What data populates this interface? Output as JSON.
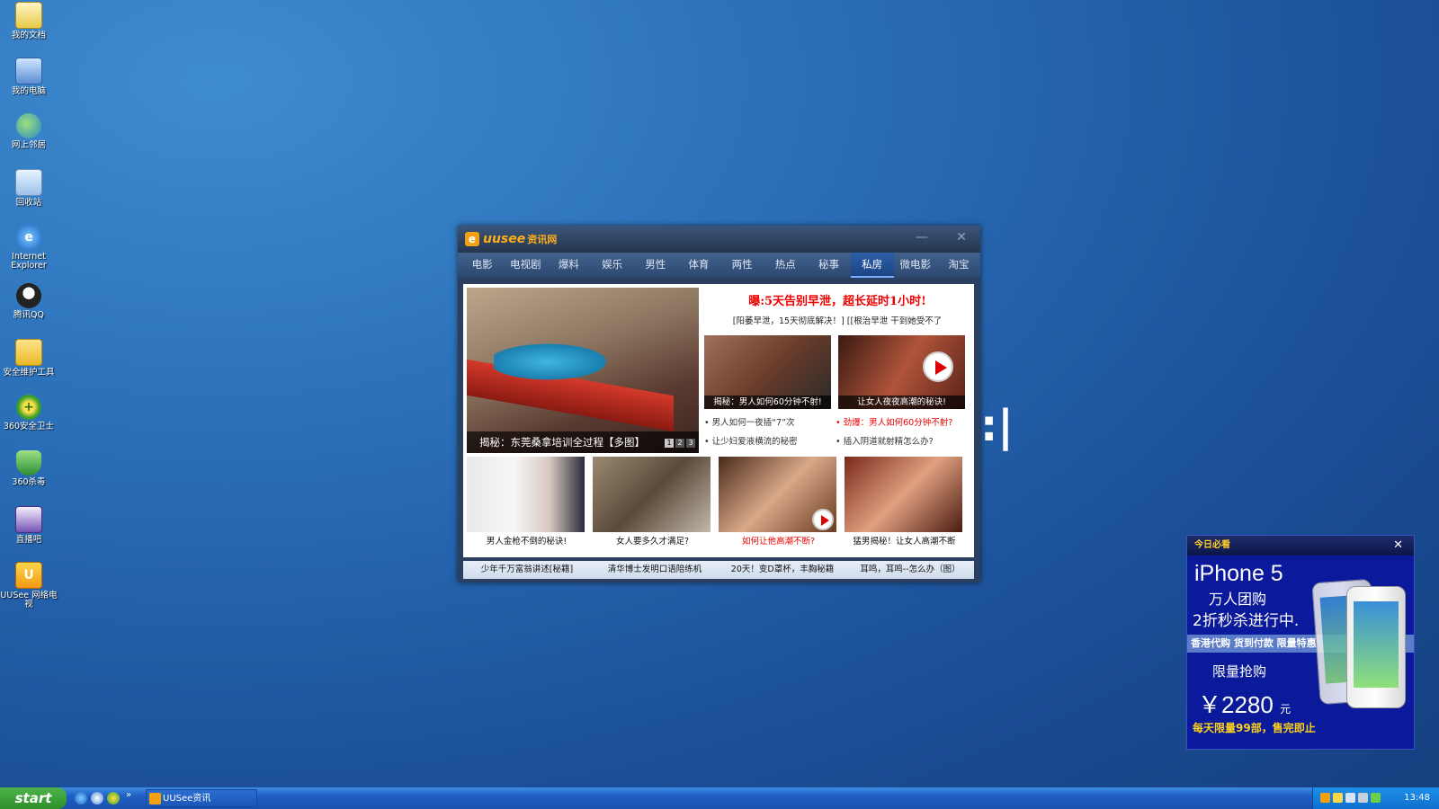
{
  "desktop": {
    "icons": [
      {
        "label": "我的文档",
        "icon": "documents-icon"
      },
      {
        "label": "我的电脑",
        "icon": "computer-icon"
      },
      {
        "label": "网上邻居",
        "icon": "network-icon"
      },
      {
        "label": "回收站",
        "icon": "recycle-bin-icon"
      },
      {
        "label": "Internet Explorer",
        "icon": "ie-icon"
      },
      {
        "label": "腾讯QQ",
        "icon": "qq-icon"
      },
      {
        "label": "安全维护工具",
        "icon": "folder-icon"
      },
      {
        "label": "360安全卫士",
        "icon": "360-safe-icon"
      },
      {
        "label": "360杀毒",
        "icon": "360-antivirus-icon"
      },
      {
        "label": "直播吧",
        "icon": "zhiboba-icon"
      },
      {
        "label": "UUSee 网络电视",
        "icon": "uusee-icon"
      }
    ],
    "stray_text": ":|"
  },
  "popup": {
    "brand": "uusee",
    "brand_sub": "资讯网",
    "nav": [
      "电影",
      "电视剧",
      "爆料",
      "娱乐",
      "男性",
      "体育",
      "两性",
      "热点",
      "秘事",
      "私房",
      "微电影",
      "淘宝"
    ],
    "active_tab": "私房",
    "hero": {
      "caption": "揭秘：东莞桑拿培训全过程【多图】",
      "pager": [
        "1",
        "2",
        "3"
      ]
    },
    "headline": "曝:5天告别早泄，超长延时1小时!",
    "subline": "[阳萎早泄，15天彻底解决！]  [[根治早泄  干到她受不了",
    "thumbs": [
      {
        "caption": "揭秘：男人如何60分钟不射!"
      },
      {
        "caption": "让女人夜夜高潮的秘诀!"
      }
    ],
    "links_left": [
      "• 男人如何一夜插“7”次",
      "• 让少妇爱液横流的秘密"
    ],
    "links_right": [
      {
        "text": "• 劲爆：男人如何60分钟不射?",
        "red": true
      },
      {
        "text": "• 插入阴道就射精怎么办?",
        "red": false
      }
    ],
    "gallery": [
      {
        "caption": "男人金枪不倒的秘诀!",
        "red": false
      },
      {
        "caption": "女人要多久才满足?",
        "red": false
      },
      {
        "caption": "如何让他高潮不断?",
        "red": true
      },
      {
        "caption": "猛男揭秘！让女人高潮不断",
        "red": false
      }
    ],
    "footer": [
      "少年千万富翁讲述[秘籍]",
      "清华博士发明口语陪练机",
      "20天！变D罩杯，丰胸秘籍",
      "耳鸣，耳鸣--怎么办（图）"
    ]
  },
  "ad": {
    "header": "今日必看",
    "line1": "iPhone 5",
    "line2": "万人团购",
    "line3": "2折秒杀进行中.",
    "band": "香港代购 货到付款 限量特惠",
    "line4": "限量抢购",
    "price": "￥2280",
    "price_unit": "元",
    "line5": "每天限量99部，售完即止"
  },
  "taskbar": {
    "start": "start",
    "window_button": "UUSee资讯",
    "clock": "13:48"
  },
  "colors": {
    "active_tab": "#1c4585",
    "headline_red": "#e00000",
    "ad_blue": "#0a1a9a",
    "ad_yellow": "#ffd21a"
  }
}
